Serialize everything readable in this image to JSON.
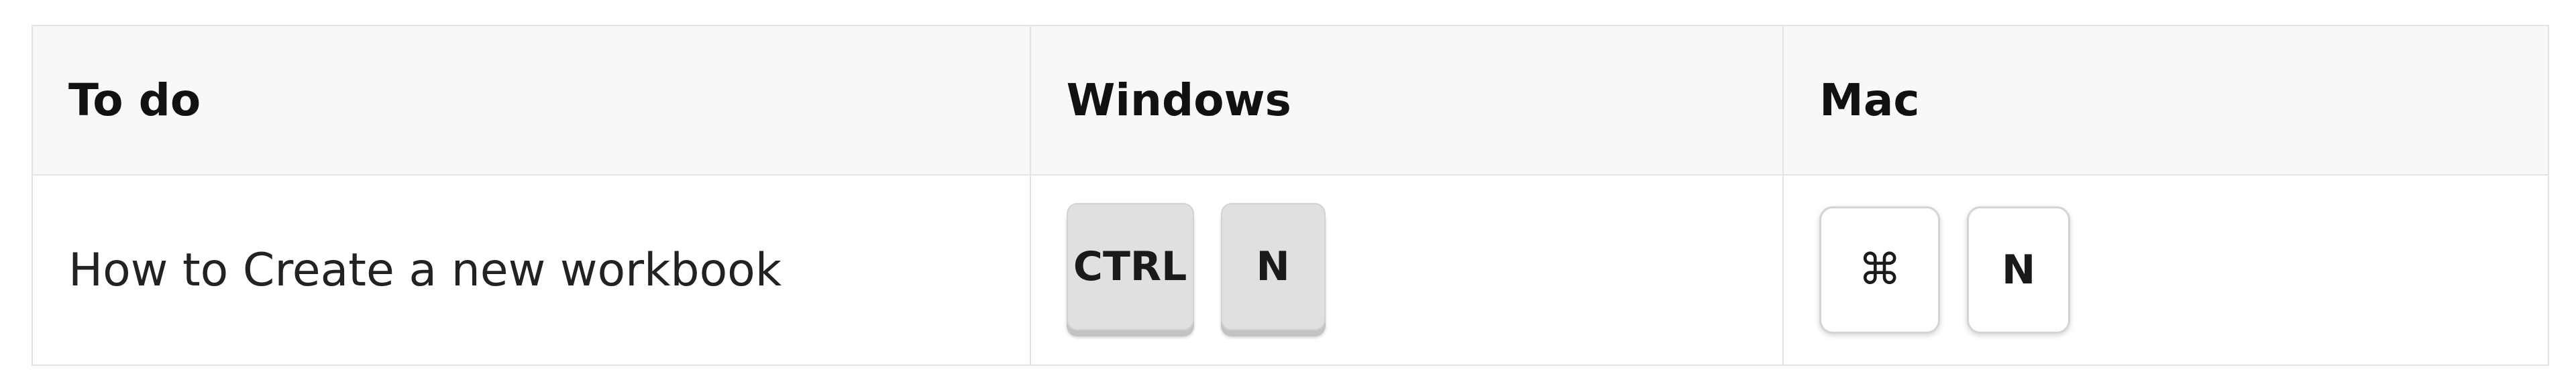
{
  "table": {
    "headers": {
      "task": "To do",
      "windows": "Windows",
      "mac": "Mac"
    },
    "rows": [
      {
        "task": "How to Create a new workbook",
        "windows_keys": [
          "CTRL",
          "N"
        ],
        "mac_keys": [
          "⌘",
          "N"
        ]
      }
    ]
  },
  "colors": {
    "header_bg": "#f8f8f8",
    "border": "#e3e3e3",
    "windows_key_bg": "#e0e0e0",
    "mac_key_bg": "#ffffff"
  },
  "icons": {
    "mac_command_key": "command-icon"
  }
}
